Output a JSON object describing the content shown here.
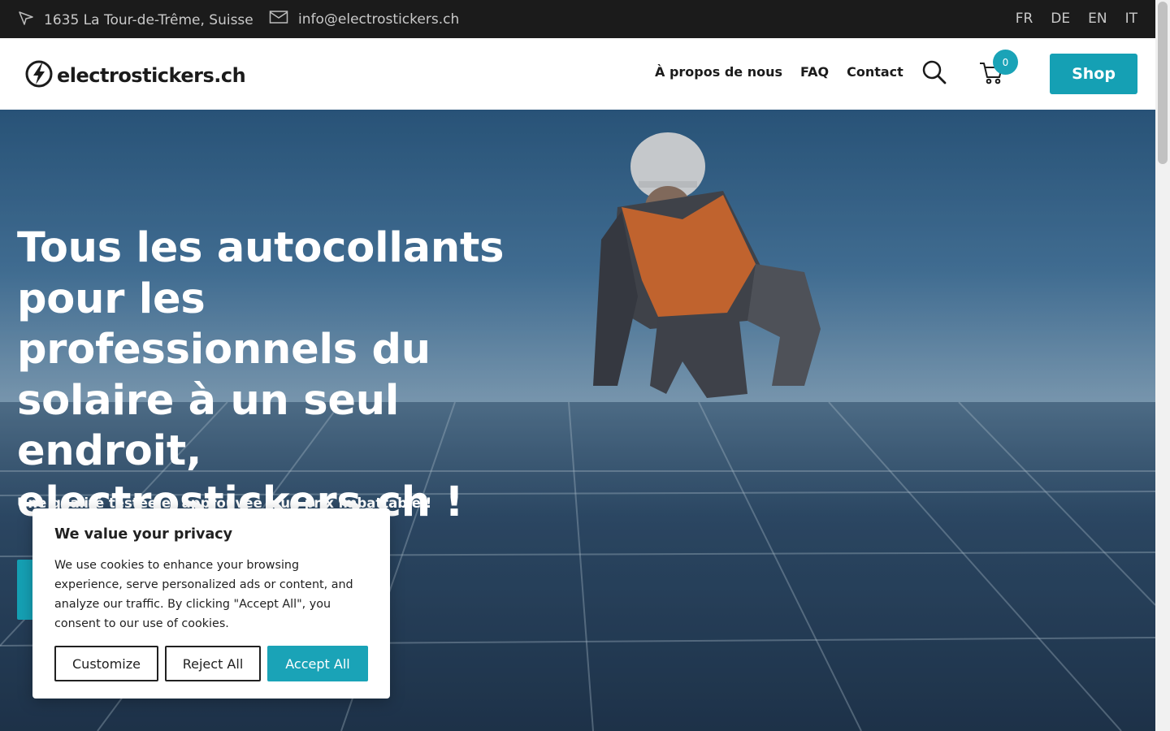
{
  "topbar": {
    "address": "1635 La Tour-de-Trême, Suisse",
    "email": "info@electrostickers.ch",
    "languages": [
      "FR",
      "DE",
      "EN",
      "IT"
    ]
  },
  "header": {
    "logo_text": "electrostickers.ch",
    "nav": [
      "À propos de nous",
      "FAQ",
      "Contact"
    ],
    "cart_count": "0",
    "shop_label": "Shop"
  },
  "hero": {
    "title": "Tous les autocollants pour les professionnels du solaire à un seul endroit, electrostickers.ch !",
    "subtitle": "Une qualité testée et approuvée à un prix imbattable !"
  },
  "cookie": {
    "title": "We value your privacy",
    "text": "We use cookies to enhance your browsing experience, serve personalized ads or content, and analyze our traffic. By clicking \"Accept All\", you consent to our use of cookies.",
    "customize_label": "Customize",
    "reject_label": "Reject All",
    "accept_label": "Accept All"
  },
  "colors": {
    "accent": "#15a0b4",
    "topbar_bg": "#1b1b1b"
  },
  "icons": {
    "address": "navigation-arrow-icon",
    "email": "envelope-icon",
    "logo": "lightning-bolt-icon",
    "search": "search-icon",
    "cart": "cart-icon"
  }
}
